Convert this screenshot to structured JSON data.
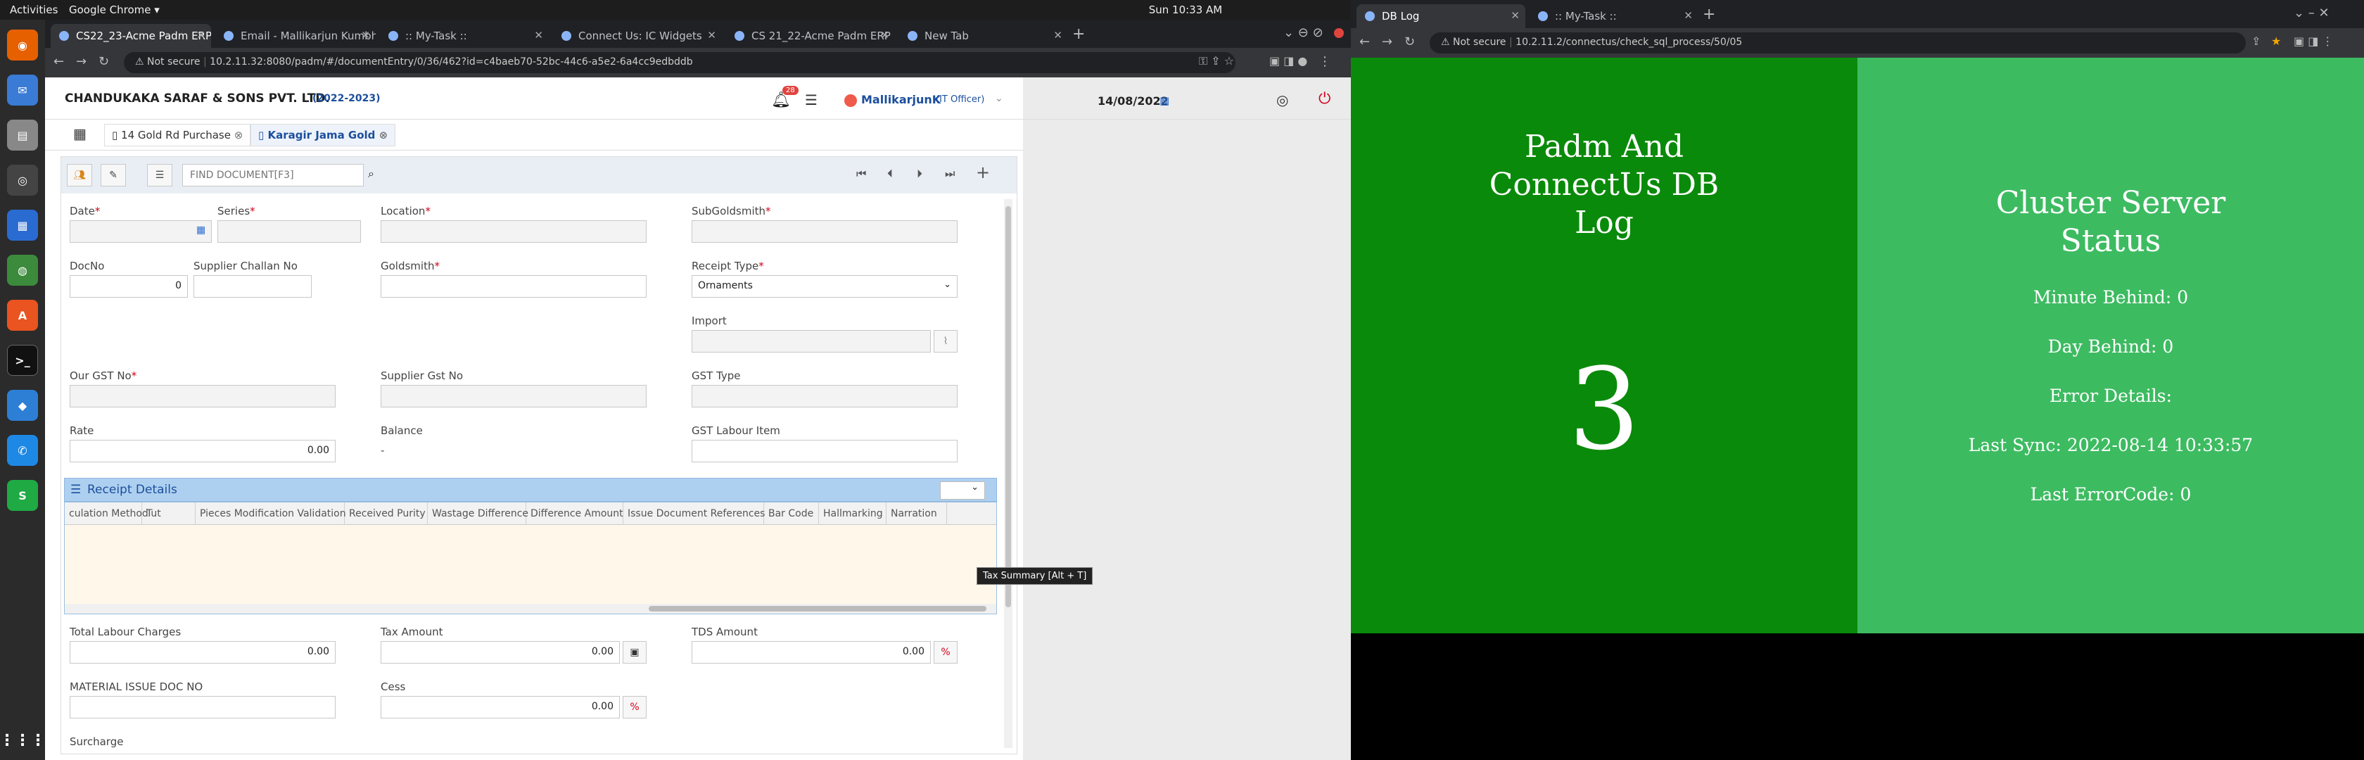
{
  "os": {
    "activities": "Activities",
    "app_menu": "Google Chrome ▾",
    "clock": "Sun 10:33 AM",
    "tray": "▴ ◀) ⏻ ▾"
  },
  "left_browser": {
    "tabs": [
      {
        "label": "CS22_23-Acme Padm ERP",
        "active": true
      },
      {
        "label": "Email - Mallikarjun Kumbh",
        "active": false
      },
      {
        "label": ":: My-Task ::",
        "active": false
      },
      {
        "label": "Connect Us: IC Widgets",
        "active": false
      },
      {
        "label": "CS 21_22-Acme Padm ERP",
        "active": false
      },
      {
        "label": "New Tab",
        "active": false
      }
    ],
    "not_secure": "Not secure",
    "url": "10.2.11.32:8080/padm/#/documentEntry/0/36/462?id=c4baeb70-52bc-44c6-a5e2-6a4cc9edbddb"
  },
  "app": {
    "company": "CHANDUKAKA SARAF & SONS PVT. LTD.",
    "year": "(2022-2023)",
    "notif_count": "28",
    "user": "MallikarjunK",
    "role": "(IT Officer)",
    "date": "14/08/2022",
    "doc_tabs": [
      "14 Gold Rd Purchase",
      "Karagir Jama Gold"
    ],
    "find_placeholder": "FIND DOCUMENT[F3]",
    "labels": {
      "date": "Date",
      "series": "Series",
      "location": "Location",
      "subgoldsmith": "SubGoldsmith",
      "docno": "DocNo",
      "supplier_challan": "Supplier Challan No",
      "goldsmith": "Goldsmith",
      "receipt_type": "Receipt Type",
      "import": "Import",
      "our_gst": "Our GST No",
      "supplier_gst": "Supplier Gst No",
      "gst_type": "GST Type",
      "rate": "Rate",
      "balance": "Balance",
      "gst_labour": "GST Labour Item",
      "total_labour": "Total Labour Charges",
      "tax_amount": "Tax Amount",
      "tds_amount": "TDS Amount",
      "material_issue": "MATERIAL ISSUE DOC NO",
      "cess": "Cess",
      "surcharge": "Surcharge"
    },
    "values": {
      "docno": "0",
      "receipt_type": "Ornaments",
      "rate": "0.00",
      "balance": "-",
      "total_labour": "0.00",
      "tax_amount": "0.00",
      "tds_amount": "0.00",
      "cess": "0.00"
    },
    "receipt_details_title": "Receipt Details",
    "grid_columns": [
      "culation Method",
      "Tut",
      "Pieces Modification Validation",
      "Received Purity",
      "Wastage Difference",
      "Difference Amount",
      "Issue Document References",
      "Bar Code",
      "Hallmarking",
      "Narration"
    ],
    "tooltip": "Tax Summary [Alt + T]",
    "percent": "%"
  },
  "right_browser": {
    "tabs": [
      {
        "label": "DB Log",
        "active": true
      },
      {
        "label": ":: My-Task ::",
        "active": false
      }
    ],
    "not_secure": "Not secure",
    "url": "10.2.11.2/connectus/check_sql_process/50/05",
    "db_title": "Padm And ConnectUs DB Log",
    "db_count": "3",
    "cluster_title": "Cluster Server Status",
    "minute_behind": "Minute Behind: 0",
    "day_behind": "Day Behind: 0",
    "error_details": "Error Details:",
    "last_sync": "Last Sync: 2022-08-14 10:33:57",
    "last_error": "Last ErrorCode: 0"
  },
  "colors": {
    "dark_green": "#0a8a0a",
    "light_green": "#3dbb61",
    "accent_blue": "#1c4f9c",
    "grid_header": "#aed0f0"
  }
}
